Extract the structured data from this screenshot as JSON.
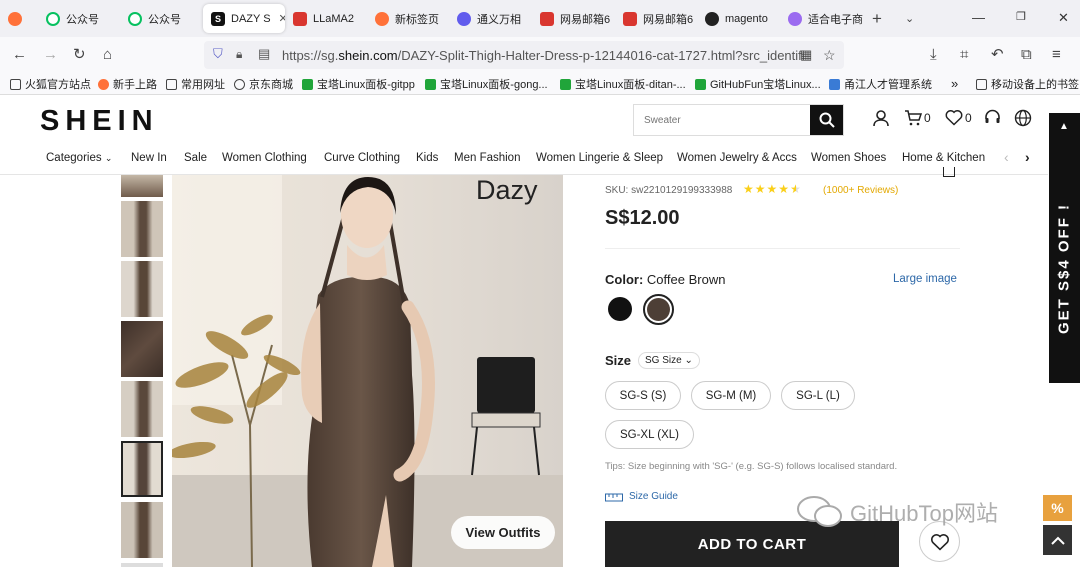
{
  "browser": {
    "tabs": [
      {
        "label": "",
        "icon": "firefox-icon",
        "color": "#ff7139"
      },
      {
        "label": "公众号",
        "icon": "wechat-icon",
        "color": "#07c160"
      },
      {
        "label": "公众号",
        "icon": "wechat-icon",
        "color": "#07c160"
      },
      {
        "label": "DAZY S",
        "icon": "shein-s-icon",
        "color": "#111111",
        "active": true
      },
      {
        "label": "LLaMA2",
        "icon": "llama-icon",
        "color": "#d9362f"
      },
      {
        "label": "新标签页",
        "icon": "firefox-icon",
        "color": "#ff7139"
      },
      {
        "label": "通义万相",
        "icon": "tongyi-icon",
        "color": "#615ced"
      },
      {
        "label": "网易邮箱6",
        "icon": "netease-mail-icon",
        "color": "#d9362f"
      },
      {
        "label": "网易邮箱6",
        "icon": "netease-mail-icon",
        "color": "#d9362f"
      },
      {
        "label": "magento",
        "icon": "github-icon",
        "color": "#222222"
      },
      {
        "label": "适合电子商",
        "icon": "app-icon",
        "color": "#9b6bf0"
      }
    ],
    "new_tab": "+",
    "url_prefix": "https://sg.",
    "url_domain": "shein.com",
    "url_rest": "/DAZY-Split-Thigh-Halter-Dress-p-12144016-cat-1727.html?src_identifi",
    "bookmarks": [
      "火狐官方站点",
      "新手上路",
      "常用网址",
      "京东商城",
      "宝塔Linux面板-gitpp",
      "宝塔Linux面板-gong...",
      "宝塔Linux面板-ditan-...",
      "GitHubFun宝塔Linux...",
      "甬江人才管理系统",
      "移动设备上的书签"
    ]
  },
  "site": {
    "logo": "SHEIN",
    "search_placeholder": "Sweater",
    "cart_count": "0",
    "wish_count": "0",
    "categories": [
      "Categories",
      "New In",
      "Sale",
      "Women Clothing",
      "Curve Clothing",
      "Kids",
      "Men Fashion",
      "Women Lingerie & Sleep",
      "Women Jewelry & Accs",
      "Women Shoes",
      "Home & Kitchen"
    ]
  },
  "product": {
    "brand_overlay": "Dazy",
    "view_outfits": "View Outfits",
    "sku": "SKU: sw2210129199333988",
    "rating": 4.5,
    "reviews": "(1000+ Reviews)",
    "price": "S$12.00",
    "color_label": "Color:",
    "color_value": "Coffee Brown",
    "large_image": "Large image",
    "swatches": [
      {
        "name": "Black",
        "hex": "#111111"
      },
      {
        "name": "Coffee Brown",
        "hex": "#4d3f36",
        "selected": true
      }
    ],
    "size_label": "Size",
    "size_system": "SG Size",
    "sizes": [
      "SG-S (S)",
      "SG-M (M)",
      "SG-L (L)",
      "SG-XL (XL)"
    ],
    "tips": "Tips: Size beginning with 'SG-' (e.g. SG-S) follows localised standard.",
    "size_guide": "Size Guide",
    "add_to_cart": "ADD TO CART"
  },
  "side_banner": "GET S$4 OFF !",
  "promo_icon": "%",
  "watermark": "GitHubTop网站"
}
